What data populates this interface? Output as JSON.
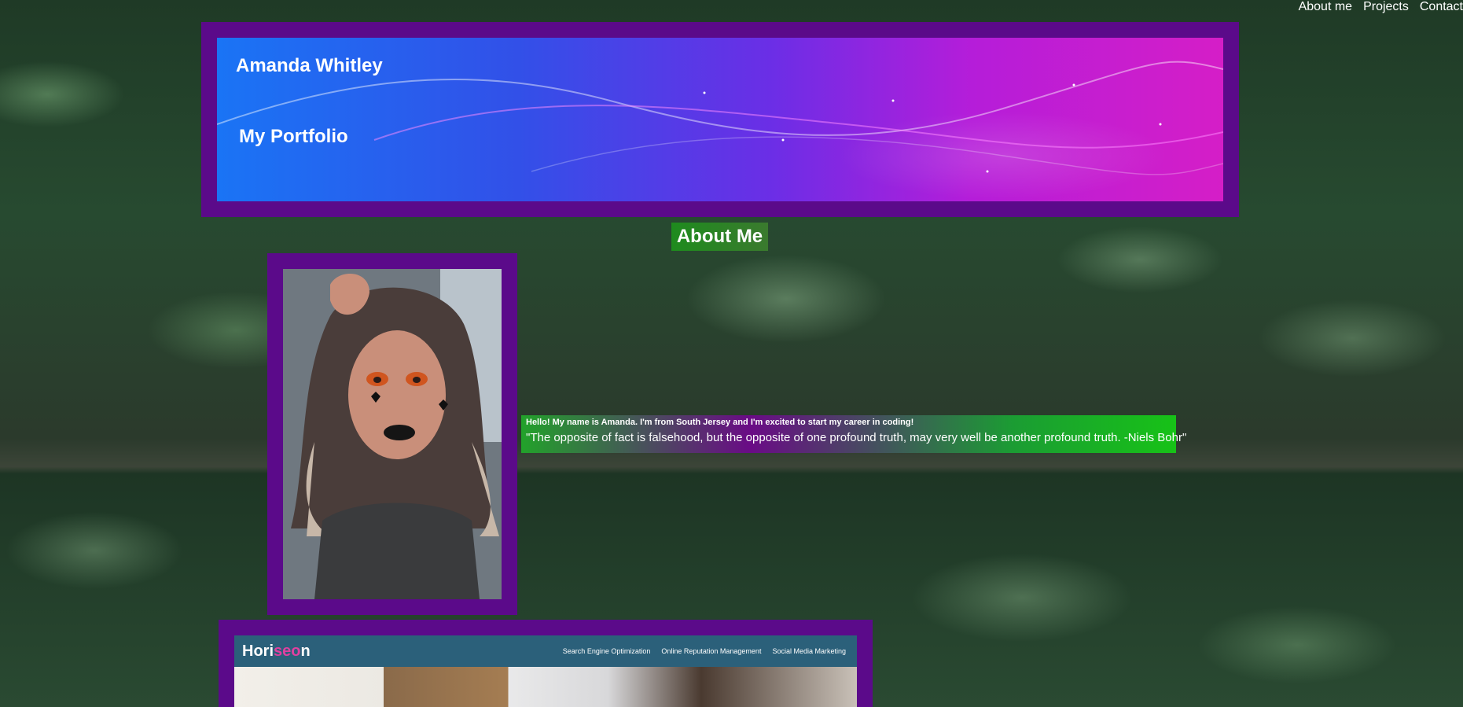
{
  "nav": {
    "items": [
      {
        "label": "About me"
      },
      {
        "label": "Projects"
      },
      {
        "label": "Contact"
      }
    ]
  },
  "header": {
    "name": "Amanda Whitley",
    "subtitle": "My Portfolio"
  },
  "about": {
    "title": "About Me",
    "intro": "Hello! My name is Amanda. I'm from South Jersey and I'm excited to start my career in coding!",
    "quote": "\"The opposite of fact is falsehood, but the opposite of one profound truth, may very well be another profound truth. -Niels Bohr\""
  },
  "project": {
    "brand_prefix": "Hori",
    "brand_accent": "seo",
    "brand_suffix": "n",
    "links": [
      {
        "label": "Search Engine Optimization"
      },
      {
        "label": "Online Reputation Management"
      },
      {
        "label": "Social Media Marketing"
      }
    ]
  },
  "colors": {
    "frame": "#5b0a8a",
    "title_bg": "#1e8b1e",
    "project_nav": "#2b607a",
    "brand_accent": "#e040a0"
  }
}
